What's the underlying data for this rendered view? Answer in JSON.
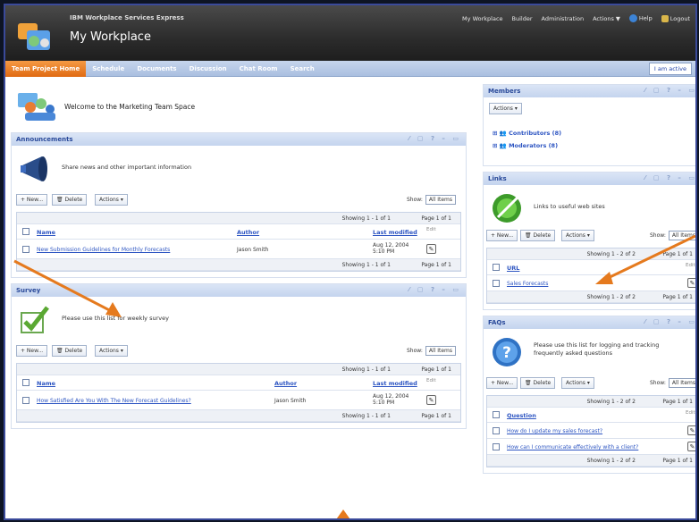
{
  "header": {
    "product": "IBM Workplace Services Express",
    "title": "My Workplace",
    "nav": [
      "My Workplace",
      "Builder",
      "Administration",
      "Actions ▼"
    ],
    "help": "Help",
    "logout": "Logout"
  },
  "tabs": [
    "Team Project Home",
    "Schedule",
    "Documents",
    "Discussion",
    "Chat Room",
    "Search"
  ],
  "edit_button": "I am active",
  "welcome": "Welcome to the Marketing Team Space",
  "common": {
    "new": "+ New...",
    "delete": "Delete",
    "actions": "Actions ▾",
    "show": "Show:",
    "all_items": "All Items",
    "page": "Page 1 of 1",
    "edit": "Edit"
  },
  "announcements": {
    "title": "Announcements",
    "desc": "Share news and other important information",
    "showing": "Showing 1 - 1 of 1",
    "columns": [
      "Name",
      "Author",
      "Last modified"
    ],
    "rows": [
      {
        "name": "New Submission Guidelines for Monthly Forecasts",
        "author": "Jason Smith",
        "date": "Aug 12, 2004",
        "time": "5:10 PM"
      }
    ]
  },
  "survey": {
    "title": "Survey",
    "desc": "Please use this list for weekly survey",
    "showing": "Showing 1 - 1 of 1",
    "columns": [
      "Name",
      "Author",
      "Last modified"
    ],
    "rows": [
      {
        "name": "How Satisfied Are You With The New Forecast Guidelines?",
        "author": "Jason Smith",
        "date": "Aug 12, 2004",
        "time": "5:10 PM"
      }
    ]
  },
  "members": {
    "title": "Members",
    "actions": "Actions ▾",
    "groups": [
      "Contributors (8)",
      "Moderators (8)"
    ]
  },
  "links": {
    "title": "Links",
    "desc": "Links to useful web sites",
    "showing": "Showing 1 - 2 of 2",
    "column": "URL",
    "rows": [
      "Sales Forecasts"
    ]
  },
  "faqs": {
    "title": "FAQs",
    "desc": "Please use this list for logging and tracking frequently asked questions",
    "showing": "Showing 1 - 2 of 2",
    "column": "Question",
    "rows": [
      "How do I update my sales forecast?",
      "How can I communicate effectively with a client?"
    ]
  },
  "colors": {
    "accent": "#e57a1e",
    "link": "#2d55c2",
    "panel_header": "#c4d4ee"
  }
}
